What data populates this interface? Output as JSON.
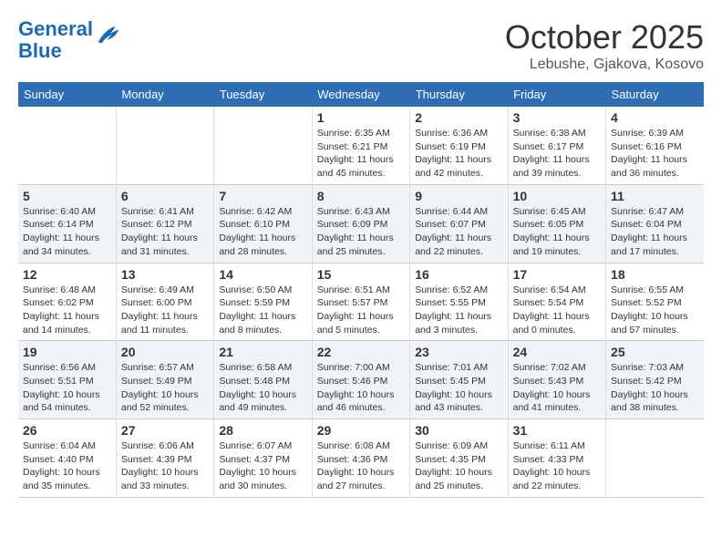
{
  "header": {
    "logo_line1": "General",
    "logo_line2": "Blue",
    "month_title": "October 2025",
    "location": "Lebushe, Gjakova, Kosovo"
  },
  "weekdays": [
    "Sunday",
    "Monday",
    "Tuesday",
    "Wednesday",
    "Thursday",
    "Friday",
    "Saturday"
  ],
  "weeks": [
    [
      {
        "day": "",
        "info": ""
      },
      {
        "day": "",
        "info": ""
      },
      {
        "day": "",
        "info": ""
      },
      {
        "day": "1",
        "info": "Sunrise: 6:35 AM\nSunset: 6:21 PM\nDaylight: 11 hours\nand 45 minutes."
      },
      {
        "day": "2",
        "info": "Sunrise: 6:36 AM\nSunset: 6:19 PM\nDaylight: 11 hours\nand 42 minutes."
      },
      {
        "day": "3",
        "info": "Sunrise: 6:38 AM\nSunset: 6:17 PM\nDaylight: 11 hours\nand 39 minutes."
      },
      {
        "day": "4",
        "info": "Sunrise: 6:39 AM\nSunset: 6:16 PM\nDaylight: 11 hours\nand 36 minutes."
      }
    ],
    [
      {
        "day": "5",
        "info": "Sunrise: 6:40 AM\nSunset: 6:14 PM\nDaylight: 11 hours\nand 34 minutes."
      },
      {
        "day": "6",
        "info": "Sunrise: 6:41 AM\nSunset: 6:12 PM\nDaylight: 11 hours\nand 31 minutes."
      },
      {
        "day": "7",
        "info": "Sunrise: 6:42 AM\nSunset: 6:10 PM\nDaylight: 11 hours\nand 28 minutes."
      },
      {
        "day": "8",
        "info": "Sunrise: 6:43 AM\nSunset: 6:09 PM\nDaylight: 11 hours\nand 25 minutes."
      },
      {
        "day": "9",
        "info": "Sunrise: 6:44 AM\nSunset: 6:07 PM\nDaylight: 11 hours\nand 22 minutes."
      },
      {
        "day": "10",
        "info": "Sunrise: 6:45 AM\nSunset: 6:05 PM\nDaylight: 11 hours\nand 19 minutes."
      },
      {
        "day": "11",
        "info": "Sunrise: 6:47 AM\nSunset: 6:04 PM\nDaylight: 11 hours\nand 17 minutes."
      }
    ],
    [
      {
        "day": "12",
        "info": "Sunrise: 6:48 AM\nSunset: 6:02 PM\nDaylight: 11 hours\nand 14 minutes."
      },
      {
        "day": "13",
        "info": "Sunrise: 6:49 AM\nSunset: 6:00 PM\nDaylight: 11 hours\nand 11 minutes."
      },
      {
        "day": "14",
        "info": "Sunrise: 6:50 AM\nSunset: 5:59 PM\nDaylight: 11 hours\nand 8 minutes."
      },
      {
        "day": "15",
        "info": "Sunrise: 6:51 AM\nSunset: 5:57 PM\nDaylight: 11 hours\nand 5 minutes."
      },
      {
        "day": "16",
        "info": "Sunrise: 6:52 AM\nSunset: 5:55 PM\nDaylight: 11 hours\nand 3 minutes."
      },
      {
        "day": "17",
        "info": "Sunrise: 6:54 AM\nSunset: 5:54 PM\nDaylight: 11 hours\nand 0 minutes."
      },
      {
        "day": "18",
        "info": "Sunrise: 6:55 AM\nSunset: 5:52 PM\nDaylight: 10 hours\nand 57 minutes."
      }
    ],
    [
      {
        "day": "19",
        "info": "Sunrise: 6:56 AM\nSunset: 5:51 PM\nDaylight: 10 hours\nand 54 minutes."
      },
      {
        "day": "20",
        "info": "Sunrise: 6:57 AM\nSunset: 5:49 PM\nDaylight: 10 hours\nand 52 minutes."
      },
      {
        "day": "21",
        "info": "Sunrise: 6:58 AM\nSunset: 5:48 PM\nDaylight: 10 hours\nand 49 minutes."
      },
      {
        "day": "22",
        "info": "Sunrise: 7:00 AM\nSunset: 5:46 PM\nDaylight: 10 hours\nand 46 minutes."
      },
      {
        "day": "23",
        "info": "Sunrise: 7:01 AM\nSunset: 5:45 PM\nDaylight: 10 hours\nand 43 minutes."
      },
      {
        "day": "24",
        "info": "Sunrise: 7:02 AM\nSunset: 5:43 PM\nDaylight: 10 hours\nand 41 minutes."
      },
      {
        "day": "25",
        "info": "Sunrise: 7:03 AM\nSunset: 5:42 PM\nDaylight: 10 hours\nand 38 minutes."
      }
    ],
    [
      {
        "day": "26",
        "info": "Sunrise: 6:04 AM\nSunset: 4:40 PM\nDaylight: 10 hours\nand 35 minutes."
      },
      {
        "day": "27",
        "info": "Sunrise: 6:06 AM\nSunset: 4:39 PM\nDaylight: 10 hours\nand 33 minutes."
      },
      {
        "day": "28",
        "info": "Sunrise: 6:07 AM\nSunset: 4:37 PM\nDaylight: 10 hours\nand 30 minutes."
      },
      {
        "day": "29",
        "info": "Sunrise: 6:08 AM\nSunset: 4:36 PM\nDaylight: 10 hours\nand 27 minutes."
      },
      {
        "day": "30",
        "info": "Sunrise: 6:09 AM\nSunset: 4:35 PM\nDaylight: 10 hours\nand 25 minutes."
      },
      {
        "day": "31",
        "info": "Sunrise: 6:11 AM\nSunset: 4:33 PM\nDaylight: 10 hours\nand 22 minutes."
      },
      {
        "day": "",
        "info": ""
      }
    ]
  ]
}
